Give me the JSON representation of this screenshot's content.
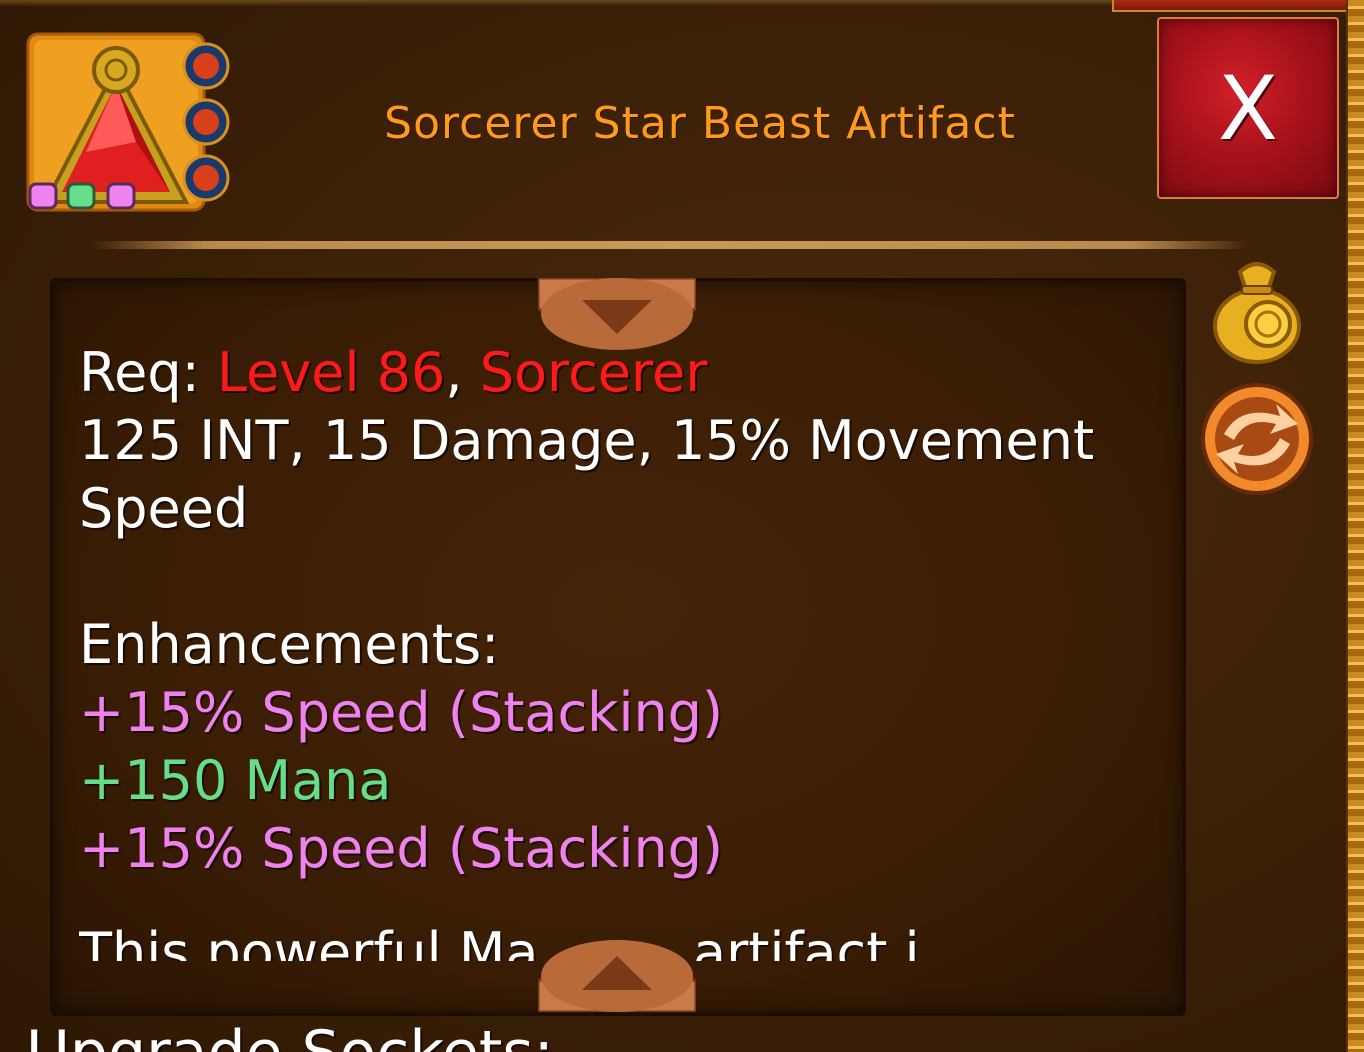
{
  "header": {
    "title": "Sorcerer Star Beast Artifact",
    "close_label": "X"
  },
  "item_icon": {
    "name": "artifact-pyramid-icon",
    "gem_slots": [
      "pink",
      "green",
      "pink"
    ],
    "rune_count": 3
  },
  "description": {
    "req_label": "Req:",
    "req_level": "Level 86",
    "req_separator": ",",
    "req_class": "Sorcerer",
    "stats_line1": "125 INT, 15 Damage, 15% Movement",
    "stats_line2": "Speed",
    "enhancements_heading": "Enhancements:",
    "enhancements": [
      {
        "text": "+15% Speed (Stacking)",
        "color": "#ee82ee"
      },
      {
        "text": "+150 Mana",
        "color": "#66dd88"
      },
      {
        "text": "+15% Speed (Stacking)",
        "color": "#ee82ee"
      }
    ],
    "truncated_line": "This powerful Ma   ...   artifact i"
  },
  "sockets_heading": "Upgrade Sockets:",
  "colors": {
    "title": "#ff9a1c",
    "requirement": "#ff1a1a",
    "close_button": "#b0141c"
  },
  "side_buttons": [
    "gold-bag-icon",
    "swap-arrows-icon"
  ]
}
